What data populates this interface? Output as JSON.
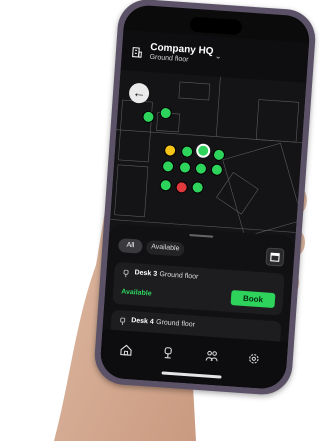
{
  "header": {
    "location_title": "Company HQ",
    "location_subtitle": "Ground floor",
    "icons": {
      "location": "building-icon",
      "dropdown": "chevron-down-icon"
    }
  },
  "map": {
    "back_icon": "arrow-left-icon",
    "seat_colors": {
      "available": "#2ed35c",
      "partial": "#f5c518",
      "occupied": "#e0393e"
    }
  },
  "filters": [
    {
      "label": "All",
      "active": true
    },
    {
      "label": "Available",
      "active": false
    }
  ],
  "calendar_icon": "calendar-icon",
  "desks": [
    {
      "name": "Desk 3",
      "floor": "Ground floor",
      "status": "Available",
      "action": "Book"
    },
    {
      "name": "Desk 4",
      "floor": "Ground floor",
      "status": "",
      "action": ""
    }
  ],
  "tabbar": {
    "tabs": [
      "home-icon",
      "desk-chair-icon",
      "people-icon",
      "settings-icon"
    ]
  },
  "colors": {
    "accent": "#2ed35c",
    "background": "#0b0b0c",
    "phone_frame": "#5c5268"
  }
}
